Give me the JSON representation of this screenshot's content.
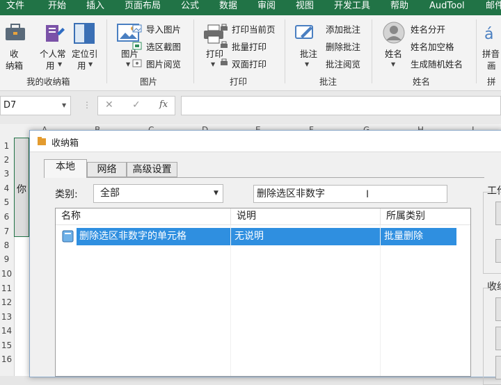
{
  "ribbon_tabs": [
    "文件",
    "开始",
    "插入",
    "页面布局",
    "公式",
    "数据",
    "审阅",
    "视图",
    "开发工具",
    "帮助",
    "AudTool",
    "邮件"
  ],
  "ribbon": {
    "storage_box": {
      "line1": "收",
      "line2": "纳箱"
    },
    "personal": {
      "line1": "个人常",
      "line2": "用"
    },
    "locate": {
      "line1": "定位引",
      "line2": "用"
    },
    "group1_label": "我的收纳箱",
    "picture": {
      "label": "图片"
    },
    "import_picture": "导入图片",
    "range_screenshot": "选区截图",
    "picture_browse": "图片阅览",
    "group2_label": "图片",
    "print": {
      "label": "打印"
    },
    "print_current": "打印当前页",
    "batch_print": "批量打印",
    "duplex_print": "双面打印",
    "group3_label": "打印",
    "comment": {
      "label": "批注"
    },
    "add_comment": "添加批注",
    "delete_comment": "删除批注",
    "comment_browse": "批注阅览",
    "group4_label": "批注",
    "name": {
      "label": "姓名"
    },
    "split_name": "姓名分开",
    "name_add_space": "姓名加空格",
    "random_name": "生成随机姓名",
    "group5_label": "姓名",
    "pinyin": {
      "line1": "拼音",
      "line2": "画"
    },
    "group6_label": "拼"
  },
  "formula_bar": {
    "name_box": "D7",
    "cancel": "✕",
    "confirm": "✓",
    "fx": "fx",
    "formula": ""
  },
  "sheet": {
    "columns": [
      "A",
      "B",
      "C",
      "D",
      "E",
      "F",
      "G",
      "H",
      "I"
    ],
    "rows": [
      "1",
      "2",
      "3",
      "4",
      "5",
      "6",
      "7",
      "8",
      "9",
      "10",
      "11",
      "12",
      "13",
      "14",
      "15",
      "16"
    ],
    "cell_a4": "你"
  },
  "dialog": {
    "title": "收纳箱",
    "tabs": [
      "本地",
      "网络",
      "高级设置"
    ],
    "category_label": "类别:",
    "category_value": "全部",
    "search_value": "删除选区非数字",
    "columns": [
      "名称",
      "说明",
      "所属类别"
    ],
    "rows": [
      {
        "name": "删除选区非数字的单元格",
        "desc": "无说明",
        "category": "批量删除"
      }
    ],
    "right_group1": "工作",
    "right_group2": "收纳"
  },
  "colors": {
    "excel_green": "#217346",
    "selection_blue": "#2f8fe0"
  }
}
